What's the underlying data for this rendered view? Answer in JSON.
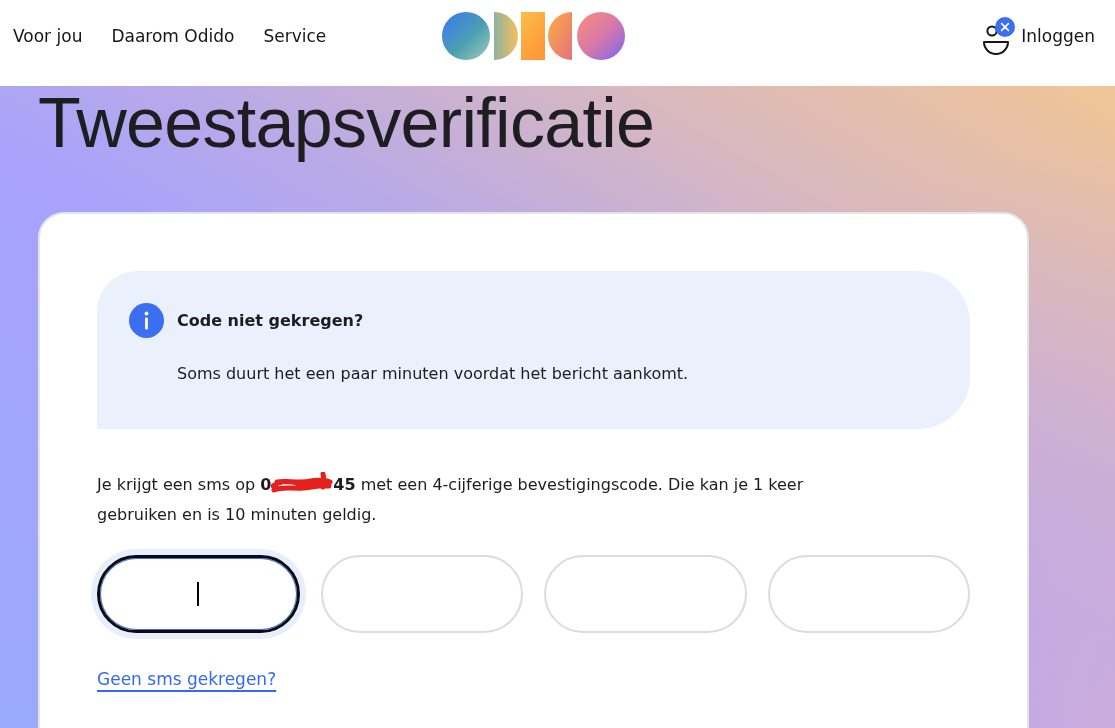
{
  "header": {
    "nav": [
      {
        "label": "Voor jou"
      },
      {
        "label": "Daarom Odido"
      },
      {
        "label": "Service"
      }
    ],
    "login": {
      "label": "Inloggen"
    }
  },
  "title": "Tweestapsverificatie",
  "info_box": {
    "title": "Code niet gekregen?",
    "text": "Soms duurt het een paar minuten voordat het bericht aankomt."
  },
  "sms_notice": {
    "text_before": "Je krijgt een sms op ",
    "phone_start": "0",
    "phone_redacted": true,
    "phone_end": "45",
    "text_after": " met een 4-cijferige bevestigingscode. Die kan je 1 keer gebruiken en is 10 minuten geldig."
  },
  "code_fields": [
    {
      "focused": true
    },
    {
      "focused": false
    },
    {
      "focused": false
    },
    {
      "focused": false
    }
  ],
  "link": "Geen sms gekregen?"
}
